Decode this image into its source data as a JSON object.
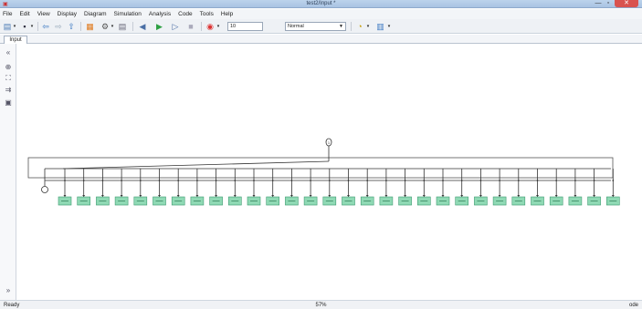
{
  "window": {
    "title": "test2/Input *",
    "min_glyph": "—",
    "max_glyph": "▫",
    "close_glyph": "✕"
  },
  "menu": [
    "File",
    "Edit",
    "View",
    "Display",
    "Diagram",
    "Simulation",
    "Analysis",
    "Code",
    "Tools",
    "Help"
  ],
  "toolbar": {
    "stop_time": "10",
    "solver_mode": "Normal"
  },
  "tabs": {
    "active": "Input"
  },
  "diagram": {
    "block_count": 30,
    "top_port_label": "1"
  },
  "status": {
    "left": "Ready",
    "zoom": "57%",
    "right": "ode"
  },
  "colors": {
    "block_fill": "#8fd9b4",
    "block_border": "#3f9c72",
    "line": "#333333"
  }
}
